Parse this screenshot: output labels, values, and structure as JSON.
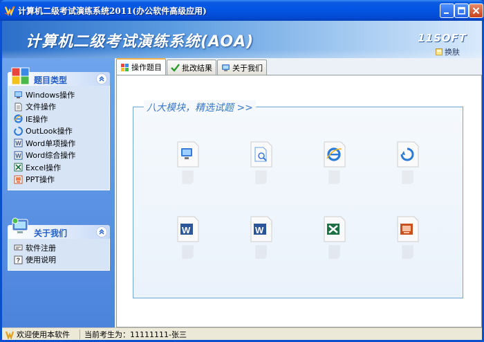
{
  "window": {
    "title": "计算机二级考试演练系统2011(办公软件高级应用)"
  },
  "banner": {
    "title": "计算机二级考试演练系统(AOA)",
    "brand": "11SOFT",
    "skin_label": "换肤"
  },
  "sidebar": {
    "categories": {
      "title": "题目类型",
      "items": [
        {
          "label": "Windows操作",
          "icon": "windows-icon"
        },
        {
          "label": "文件操作",
          "icon": "file-icon"
        },
        {
          "label": "IE操作",
          "icon": "ie-icon"
        },
        {
          "label": "OutLook操作",
          "icon": "outlook-icon"
        },
        {
          "label": "Word单项操作",
          "icon": "word-icon"
        },
        {
          "label": "Word综合操作",
          "icon": "word-icon"
        },
        {
          "label": "Excel操作",
          "icon": "excel-icon"
        },
        {
          "label": "PPT操作",
          "icon": "ppt-icon"
        }
      ]
    },
    "about": {
      "title": "关于我们",
      "items": [
        {
          "label": "软件注册",
          "icon": "register-icon"
        },
        {
          "label": "使用说明",
          "icon": "help-icon"
        }
      ]
    }
  },
  "tabs": [
    {
      "label": "操作题目",
      "active": true
    },
    {
      "label": "批改结果",
      "active": false
    },
    {
      "label": "关于我们",
      "active": false
    }
  ],
  "main": {
    "legend": "八大模块，精选试题 >>",
    "modules": [
      {
        "icon": "windows-module-icon"
      },
      {
        "icon": "file-module-icon"
      },
      {
        "icon": "ie-module-icon"
      },
      {
        "icon": "outlook-module-icon"
      },
      {
        "icon": "word-single-module-icon"
      },
      {
        "icon": "word-comprehensive-module-icon"
      },
      {
        "icon": "excel-module-icon"
      },
      {
        "icon": "ppt-module-icon"
      }
    ]
  },
  "statusbar": {
    "welcome": "欢迎使用本软件",
    "candidate": "当前考生为：11111111-张三"
  },
  "colors": {
    "titlebar": "#0456e6",
    "sidebar": "#5a90e2",
    "panel_title": "#215dc6",
    "legend": "#3a78c8"
  }
}
